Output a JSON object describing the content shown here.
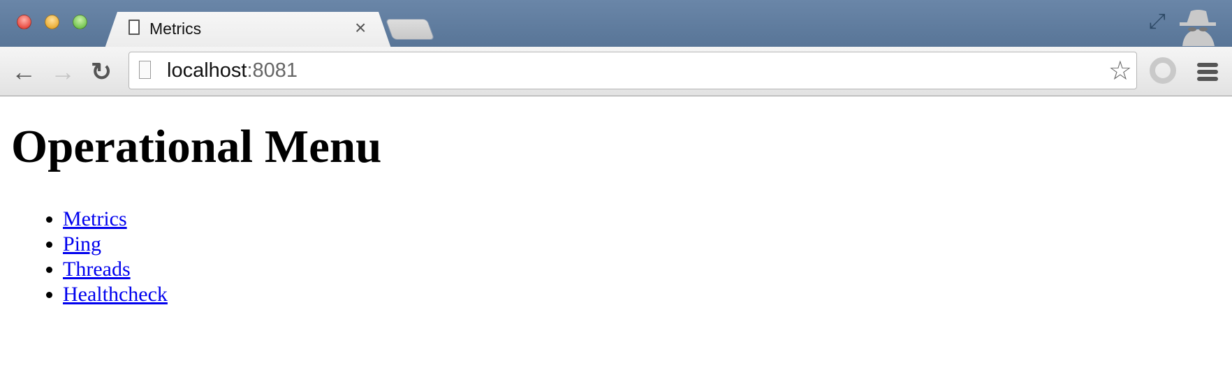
{
  "browser": {
    "tab_title": "Metrics",
    "url_host": "localhost",
    "url_port": ":8081",
    "close_glyph": "×",
    "back_glyph": "←",
    "forward_glyph": "→",
    "reload_glyph": "↻",
    "star_glyph": "☆",
    "fullscreen_glyph": "⤢"
  },
  "page": {
    "title": "Operational Menu",
    "links": [
      {
        "label": "Metrics"
      },
      {
        "label": "Ping"
      },
      {
        "label": "Threads"
      },
      {
        "label": "Healthcheck"
      }
    ]
  },
  "colors": {
    "link": "#0000ee",
    "titlebar": "#5f7c9e"
  }
}
